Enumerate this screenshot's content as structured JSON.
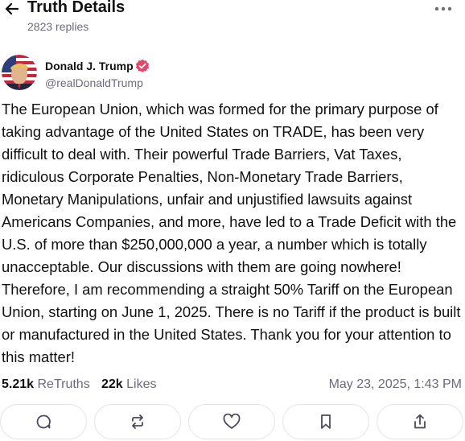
{
  "header": {
    "title": "Truth Details",
    "replies": "2823 replies",
    "back_icon": "arrow-left-icon",
    "more_icon": "more-horizontal-icon"
  },
  "author": {
    "name": "Donald J. Trump",
    "handle": "@realDonaldTrump",
    "verified": true,
    "verified_color": "#e5466b"
  },
  "post": {
    "text": "The European Union, which was formed for the primary purpose of taking advantage of the United States on TRADE, has been very difficult to deal with. Their powerful Trade Barriers, Vat Taxes, ridiculous Corporate Penalties, Non-Monetary Trade Barriers, Monetary Manipulations, unfair and unjustified lawsuits against Americans Companies, and more, have led to a Trade Deficit with the U.S. of more than $250,000,000 a year, a number which is totally unacceptable. Our discussions with them are going nowhere! Therefore, I am recommending a straight 50% Tariff on the European Union, starting on June 1, 2025. There is no Tariff if the product is built or manufactured in the United States. Thank you for your attention to this matter!"
  },
  "stats": {
    "retruths_count": "5.21k",
    "retruths_label": "ReTruths",
    "likes_count": "22k",
    "likes_label": "Likes",
    "timestamp": "May 23, 2025, 1:43 PM"
  },
  "actions": [
    {
      "icon": "reply-icon"
    },
    {
      "icon": "retruth-icon"
    },
    {
      "icon": "like-icon"
    },
    {
      "icon": "bookmark-icon"
    },
    {
      "icon": "share-icon"
    }
  ],
  "colors": {
    "text": "#111111",
    "muted": "#6b6b7b",
    "border": "#e3e3ea",
    "icon": "#4a4a5a"
  }
}
